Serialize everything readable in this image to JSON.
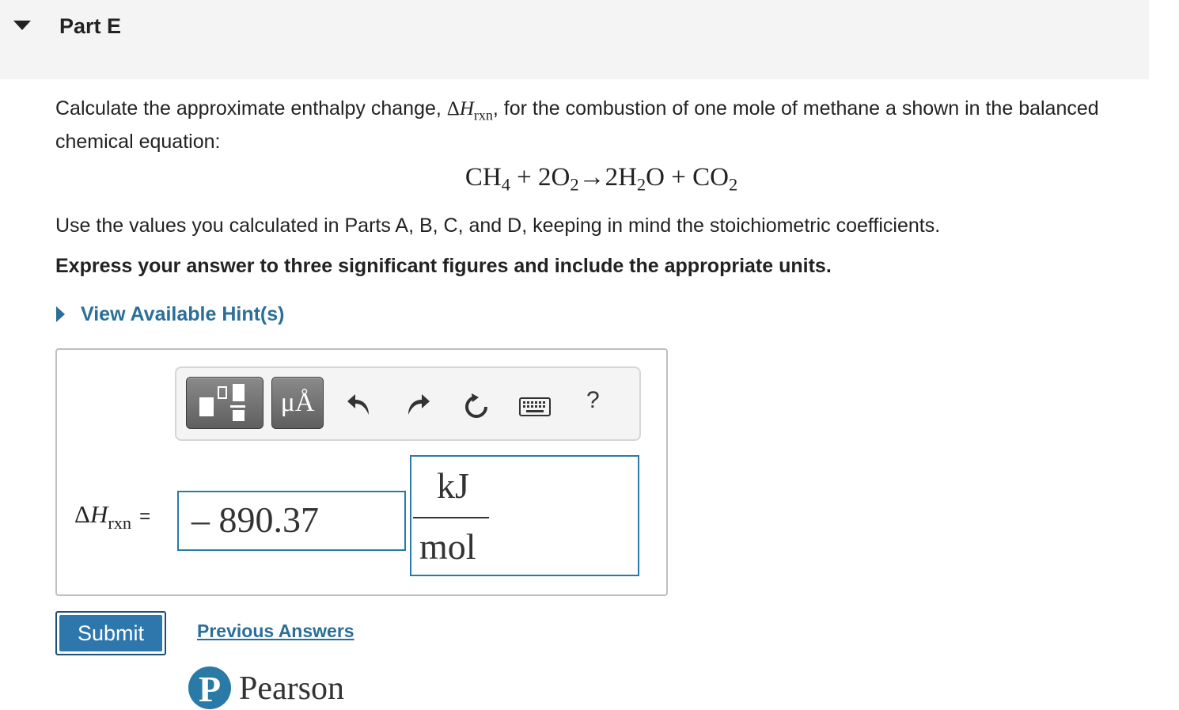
{
  "header": {
    "part_title": "Part E"
  },
  "question": {
    "line1_pre": "Calculate the approximate enthalpy change, ",
    "delta_symbol": "Δ",
    "h_symbol": "H",
    "h_subscript": "rxn",
    "line1_post": ", for the combustion of one mole of methane a shown in the balanced chemical equation:",
    "equation": {
      "ch": "CH",
      "ch_sub": "4",
      "plus1": " + 2O",
      "o2_sub": "2",
      "arrow": "→",
      "h2o_pre": "2H",
      "h2o_sub": "2",
      "h2o_post": "O",
      "plus2": " + CO",
      "co2_sub": "2"
    },
    "instruction": "Use the values you calculated in Parts A, B, C, and D, keeping in mind the stoichiometric coefficients.",
    "express": "Express your answer to three significant figures and include the appropriate units."
  },
  "hint": {
    "label": "View Available Hint(s)"
  },
  "toolbar": {
    "units_label": "μÅ",
    "help_label": "?",
    "icons": [
      "templates-icon",
      "units-icon",
      "undo-icon",
      "redo-icon",
      "reset-icon",
      "keyboard-icon",
      "help-icon"
    ]
  },
  "answer": {
    "lhs_delta": "Δ",
    "lhs_h": "H",
    "lhs_sub": "rxn",
    "equals": "=",
    "value": "– 890.37",
    "unit_numerator": "kJ",
    "unit_denominator": "mol"
  },
  "actions": {
    "submit_label": "Submit",
    "previous_answers_label": "Previous Answers"
  },
  "footer": {
    "brand": "Pearson",
    "logo_letter": "P"
  },
  "colors": {
    "link": "#2a6f99",
    "submit_bg": "#2e77ad",
    "field_border": "#2a7aa8",
    "header_bg": "#f4f4f4"
  }
}
